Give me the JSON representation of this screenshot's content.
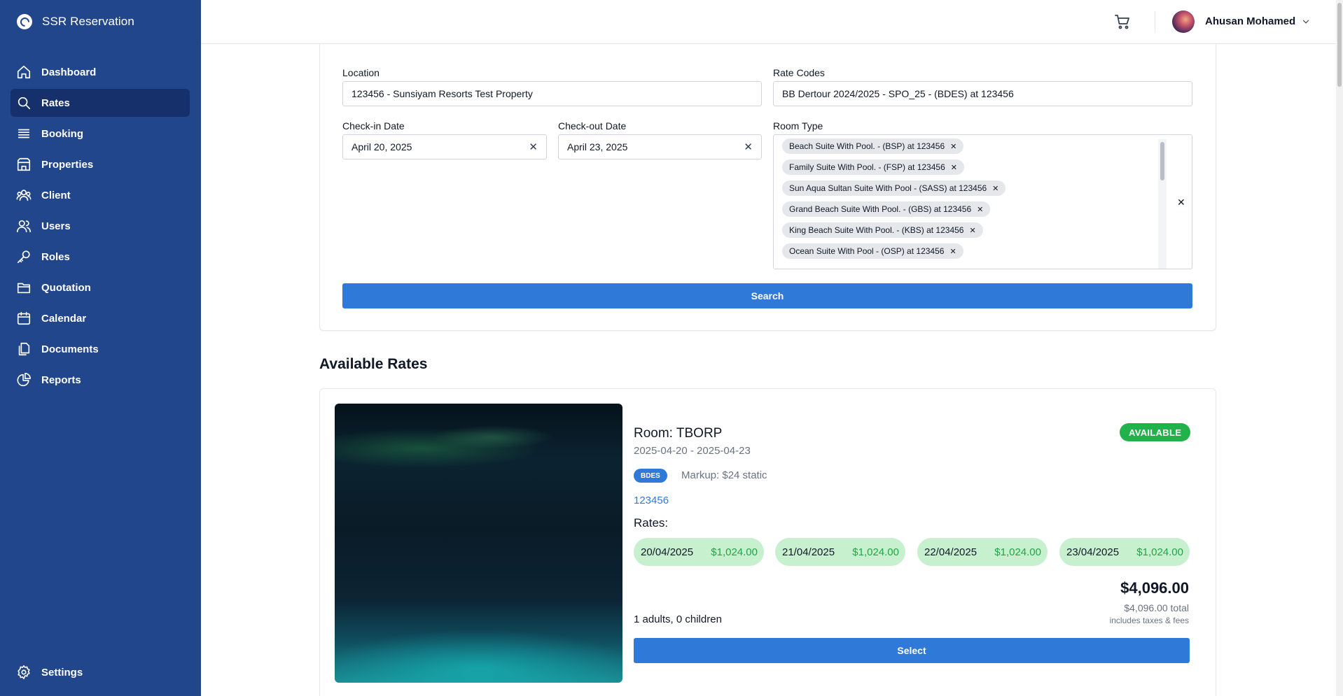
{
  "app": {
    "brand": "SSR Reservation"
  },
  "sidebar": {
    "items": [
      {
        "label": "Dashboard",
        "icon": "home-icon"
      },
      {
        "label": "Rates",
        "icon": "search-icon",
        "active": true
      },
      {
        "label": "Booking",
        "icon": "list-icon"
      },
      {
        "label": "Properties",
        "icon": "building-icon"
      },
      {
        "label": "Client",
        "icon": "client-icon"
      },
      {
        "label": "Users",
        "icon": "users-icon"
      },
      {
        "label": "Roles",
        "icon": "key-icon"
      },
      {
        "label": "Quotation",
        "icon": "folder-icon"
      },
      {
        "label": "Calendar",
        "icon": "calendar-icon"
      },
      {
        "label": "Documents",
        "icon": "documents-icon"
      },
      {
        "label": "Reports",
        "icon": "pie-chart-icon"
      }
    ],
    "settings": {
      "label": "Settings",
      "icon": "gear-icon"
    }
  },
  "topbar": {
    "user_name": "Ahusan Mohamed"
  },
  "search": {
    "location_label": "Location",
    "location_value": "123456 - Sunsiyam Resorts Test Property",
    "rate_codes_label": "Rate Codes",
    "rate_codes_value": "BB Dertour 2024/2025 - SPO_25 - (BDES) at 123456",
    "checkin_label": "Check-in Date",
    "checkin_value": "April 20, 2025",
    "checkout_label": "Check-out Date",
    "checkout_value": "April 23, 2025",
    "room_type_label": "Room Type",
    "room_types": [
      "Beach Suite With Pool. - (BSP) at 123456",
      "Family Suite With Pool. - (FSP) at 123456",
      "Sun Aqua Sultan Suite With Pool - (SASS) at 123456",
      "Grand Beach Suite With Pool. - (GBS) at 123456",
      "King Beach Suite With Pool. - (KBS) at 123456",
      "Ocean Suite With Pool - (OSP) at 123456"
    ],
    "clear_symbol": "✕",
    "chip_remove_symbol": "✕",
    "search_button": "Search"
  },
  "results": {
    "title": "Available Rates",
    "card": {
      "room": "Room: TBORP",
      "dates": "2025-04-20 - 2025-04-23",
      "status": "AVAILABLE",
      "code": "BDES",
      "markup": "Markup: $24 static",
      "property": "123456",
      "rates_label": "Rates:",
      "rates": [
        {
          "date": "20/04/2025",
          "price": "$1,024.00"
        },
        {
          "date": "21/04/2025",
          "price": "$1,024.00"
        },
        {
          "date": "22/04/2025",
          "price": "$1,024.00"
        },
        {
          "date": "23/04/2025",
          "price": "$1,024.00"
        }
      ],
      "total": "$4,096.00",
      "total_sub": "$4,096.00 total",
      "total_note": "includes taxes & fees",
      "guests": "1 adults, 0 children",
      "select_button": "Select"
    }
  },
  "colors": {
    "sidebar": "#21468c",
    "sidebar_active": "#15306a",
    "primary": "#2f7ad9",
    "available": "#22b24c",
    "rate_pill": "#c7f0cf",
    "rate_price": "#22a447"
  }
}
